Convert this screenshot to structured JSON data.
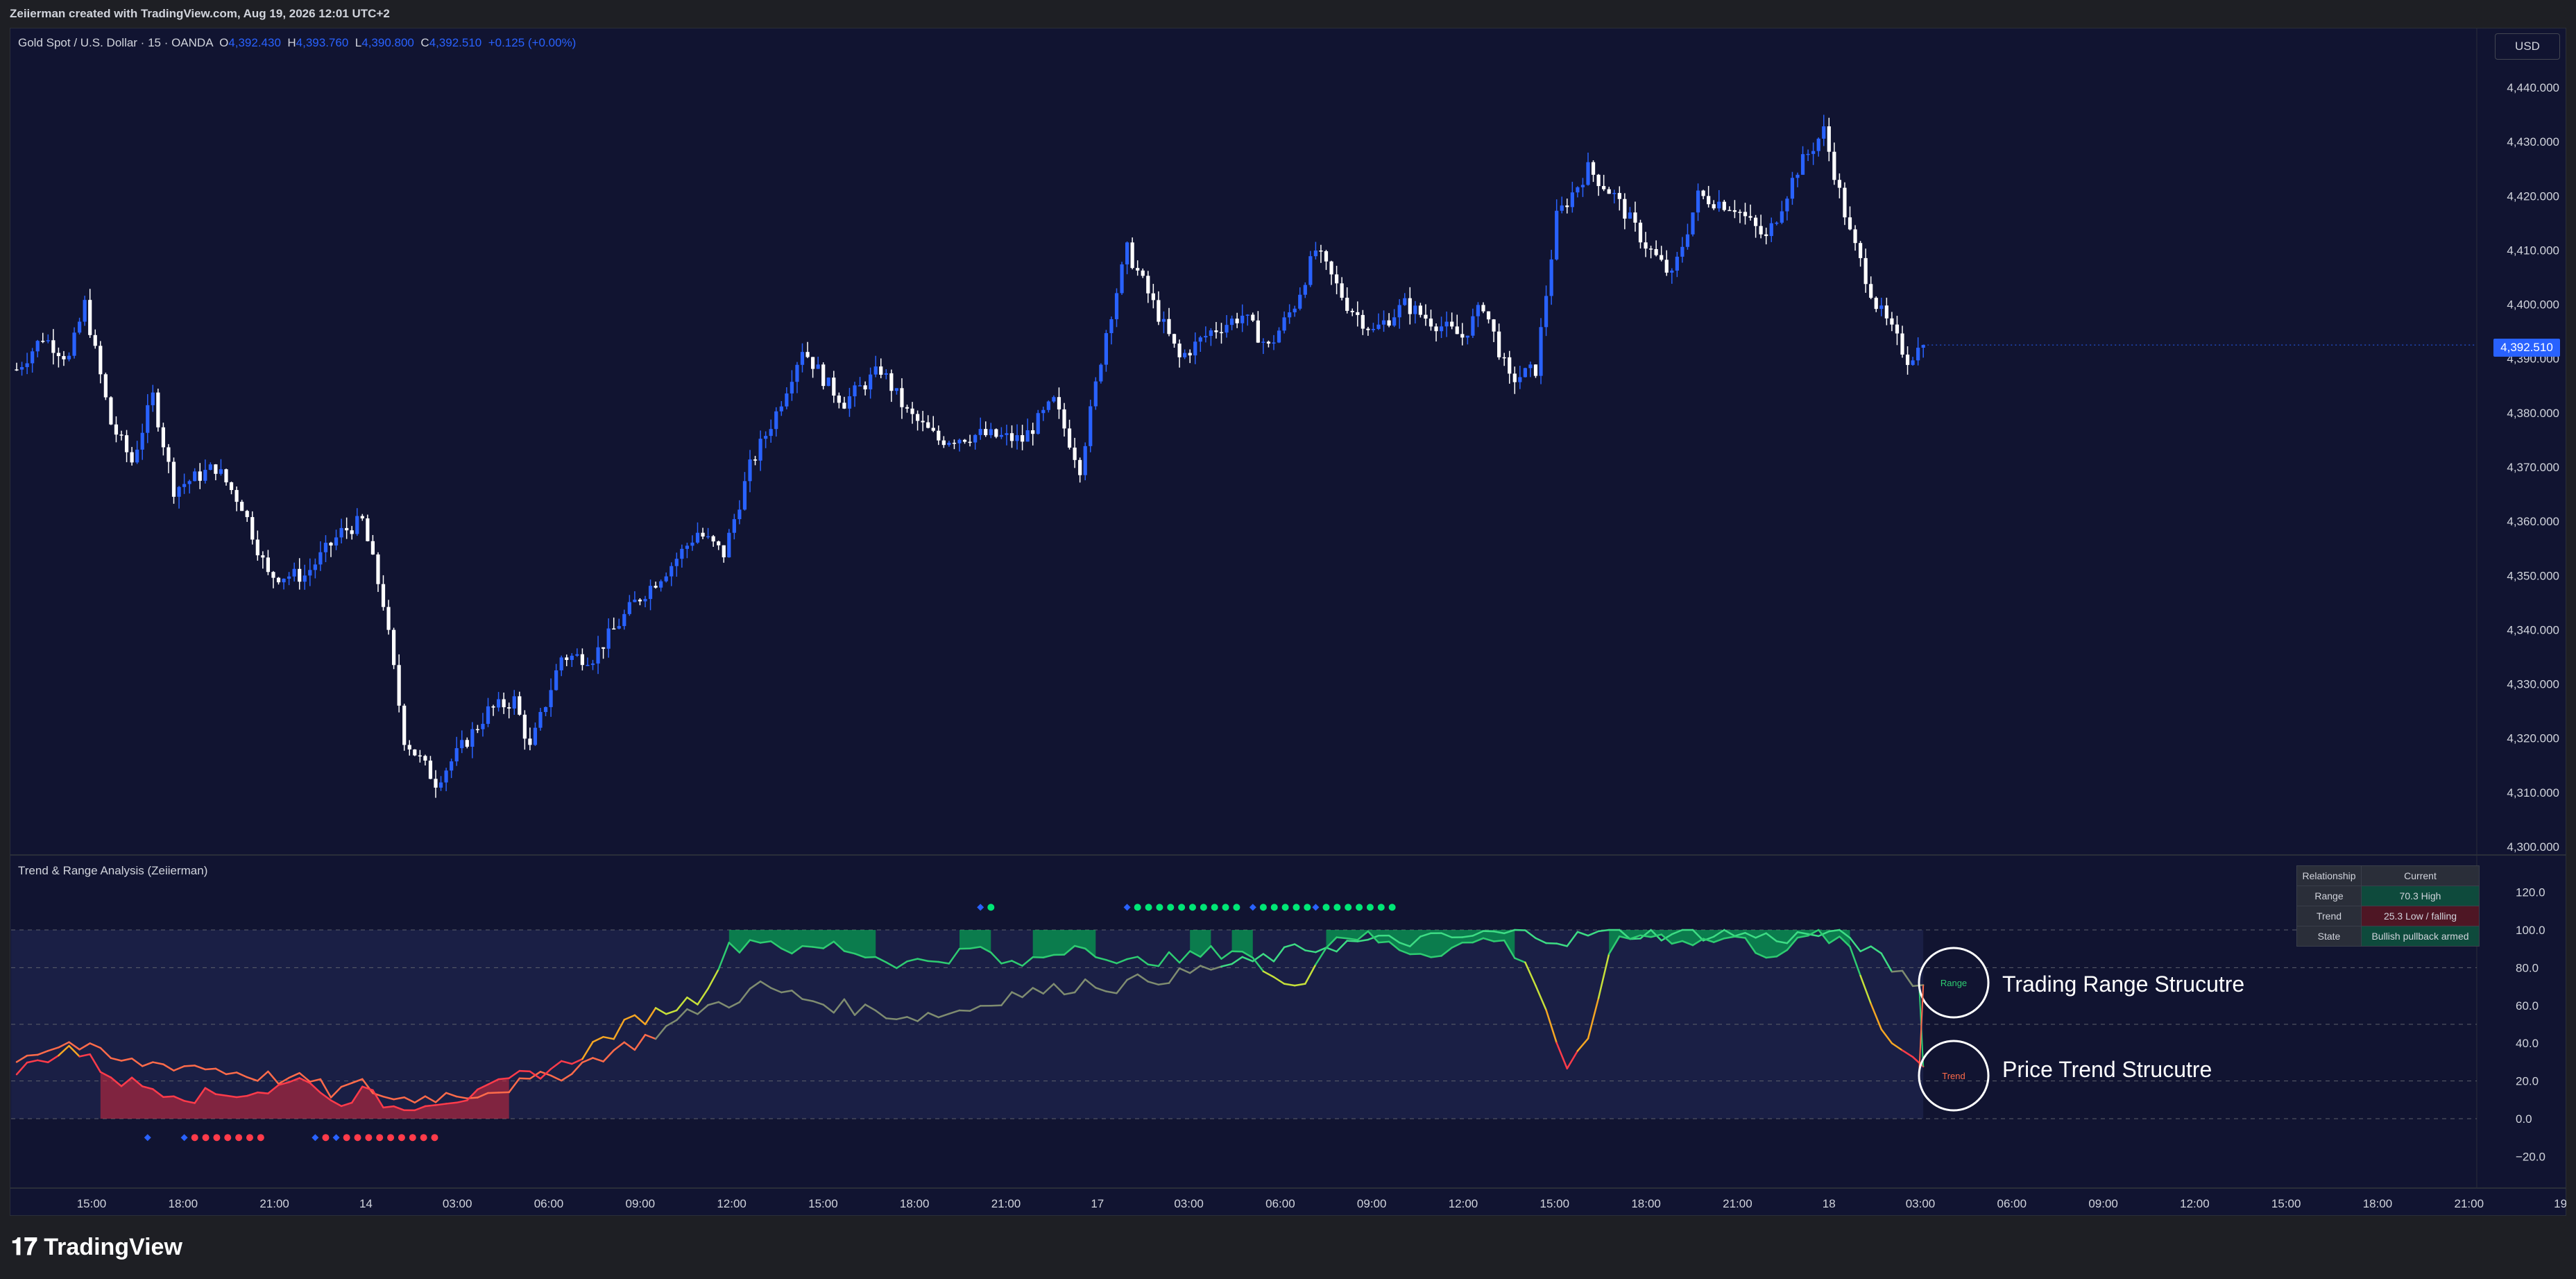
{
  "caption": "Zeiierman created with TradingView.com, Aug 19, 2026 12:01 UTC+2",
  "symbol": {
    "name": "Gold Spot / U.S. Dollar · 15 · OANDA",
    "o_label": "O",
    "o": "4,392.430",
    "h_label": "H",
    "h": "4,393.760",
    "l_label": "L",
    "l": "4,390.800",
    "c_label": "C",
    "c": "4,392.510",
    "change": "+0.125 (+0.00%)"
  },
  "currency": "USD",
  "last_price": "4,392.510",
  "price_axis": [
    "4,440.000",
    "4,430.000",
    "4,420.000",
    "4,410.000",
    "4,400.000",
    "4,390.000",
    "4,380.000",
    "4,370.000",
    "4,360.000",
    "4,350.000",
    "4,340.000",
    "4,330.000",
    "4,320.000",
    "4,310.000",
    "4,300.000"
  ],
  "indicator": {
    "title": "Trend & Range Analysis (Zeiierman)",
    "axis": [
      "120.0",
      "100.0",
      "80.0",
      "60.0",
      "40.0",
      "20.0",
      "0.0",
      "−20.0"
    ],
    "table": {
      "headers": [
        "Relationship",
        "Current"
      ],
      "rows": [
        {
          "label": "Range",
          "value": "70.3  High"
        },
        {
          "label": "Trend",
          "value": "25.3  Low / falling"
        },
        {
          "label": "State",
          "value": "Bullish pullback armed"
        }
      ]
    },
    "range_marker": "Range",
    "trend_marker": "Trend",
    "range_label": "Trading Range Strucutre",
    "trend_label": "Price Trend Strucutre"
  },
  "time_axis": [
    "15:00",
    "18:00",
    "21:00",
    "14",
    "03:00",
    "06:00",
    "09:00",
    "12:00",
    "15:00",
    "18:00",
    "21:00",
    "17",
    "03:00",
    "06:00",
    "09:00",
    "12:00",
    "15:00",
    "18:00",
    "21:00",
    "18",
    "03:00",
    "06:00",
    "09:00",
    "12:00",
    "15:00",
    "18:00",
    "21:00",
    "19"
  ],
  "footer_logo": "TradingView",
  "colors": {
    "background": "#111431",
    "up_candle": "#2962ff",
    "down_candle": "#ffffff",
    "range_line": "#00e676",
    "trend_line": "#ff5252",
    "accent": "#2962ff"
  },
  "chart_data": {
    "type": "candlestick",
    "price_range": [
      4300,
      4440
    ],
    "last_close": 4392.51,
    "price_path": [
      [
        0,
        4388
      ],
      [
        5,
        4394
      ],
      [
        10,
        4390
      ],
      [
        13,
        4400
      ],
      [
        18,
        4378
      ],
      [
        22,
        4371
      ],
      [
        26,
        4383
      ],
      [
        30,
        4366
      ],
      [
        38,
        4370
      ],
      [
        43,
        4363
      ],
      [
        48,
        4350
      ],
      [
        55,
        4350
      ],
      [
        62,
        4358
      ],
      [
        66,
        4360
      ],
      [
        70,
        4345
      ],
      [
        74,
        4320
      ],
      [
        80,
        4312
      ],
      [
        84,
        4317
      ],
      [
        90,
        4325
      ],
      [
        95,
        4327
      ],
      [
        98,
        4318
      ],
      [
        104,
        4335
      ],
      [
        110,
        4335
      ],
      [
        118,
        4345
      ],
      [
        125,
        4352
      ],
      [
        130,
        4358
      ],
      [
        135,
        4354
      ],
      [
        140,
        4370
      ],
      [
        145,
        4380
      ],
      [
        150,
        4392
      ],
      [
        155,
        4385
      ],
      [
        158,
        4382
      ],
      [
        165,
        4388
      ],
      [
        170,
        4380
      ],
      [
        176,
        4375
      ],
      [
        184,
        4376
      ],
      [
        192,
        4375
      ],
      [
        198,
        4382
      ],
      [
        203,
        4370
      ],
      [
        208,
        4395
      ],
      [
        212,
        4410
      ],
      [
        217,
        4400
      ],
      [
        222,
        4390
      ],
      [
        228,
        4395
      ],
      [
        234,
        4398
      ],
      [
        239,
        4392
      ],
      [
        244,
        4400
      ],
      [
        248,
        4410
      ],
      [
        254,
        4400
      ],
      [
        259,
        4395
      ],
      [
        265,
        4400
      ],
      [
        270,
        4397
      ],
      [
        276,
        4394
      ],
      [
        280,
        4400
      ],
      [
        285,
        4386
      ],
      [
        290,
        4388
      ],
      [
        294,
        4416
      ],
      [
        300,
        4425
      ],
      [
        305,
        4420
      ],
      [
        311,
        4411
      ],
      [
        316,
        4405
      ],
      [
        321,
        4420
      ],
      [
        328,
        4418
      ],
      [
        334,
        4412
      ],
      [
        340,
        4425
      ],
      [
        345,
        4432
      ],
      [
        350,
        4413
      ],
      [
        355,
        4400
      ],
      [
        358,
        4395
      ],
      [
        361,
        4390
      ],
      [
        364,
        4392.51
      ]
    ],
    "range_series": [
      [
        0,
        25
      ],
      [
        10,
        38
      ],
      [
        20,
        20
      ],
      [
        34,
        12
      ],
      [
        48,
        15
      ],
      [
        56,
        22
      ],
      [
        60,
        8
      ],
      [
        66,
        14
      ],
      [
        72,
        6
      ],
      [
        80,
        10
      ],
      [
        88,
        12
      ],
      [
        96,
        22
      ],
      [
        104,
        28
      ],
      [
        112,
        42
      ],
      [
        118,
        52
      ],
      [
        124,
        58
      ],
      [
        130,
        64
      ],
      [
        136,
        90
      ],
      [
        142,
        96
      ],
      [
        150,
        88
      ],
      [
        156,
        92
      ],
      [
        162,
        87
      ],
      [
        170,
        82
      ],
      [
        178,
        86
      ],
      [
        184,
        90
      ],
      [
        190,
        80
      ],
      [
        198,
        88
      ],
      [
        204,
        94
      ],
      [
        210,
        80
      ],
      [
        216,
        85
      ],
      [
        222,
        84
      ],
      [
        228,
        88
      ],
      [
        234,
        90
      ],
      [
        240,
        72
      ],
      [
        246,
        75
      ],
      [
        252,
        98
      ],
      [
        258,
        96
      ],
      [
        264,
        90
      ],
      [
        270,
        88
      ],
      [
        276,
        92
      ],
      [
        282,
        96
      ],
      [
        288,
        84
      ],
      [
        292,
        58
      ],
      [
        296,
        24
      ],
      [
        300,
        40
      ],
      [
        304,
        90
      ],
      [
        310,
        98
      ],
      [
        316,
        96
      ],
      [
        322,
        94
      ],
      [
        328,
        96
      ],
      [
        334,
        88
      ],
      [
        338,
        90
      ],
      [
        344,
        98
      ],
      [
        350,
        90
      ],
      [
        356,
        48
      ],
      [
        360,
        38
      ],
      [
        364,
        27
      ]
    ],
    "trend_series": [
      [
        0,
        33
      ],
      [
        10,
        40
      ],
      [
        20,
        30
      ],
      [
        34,
        28
      ],
      [
        48,
        22
      ],
      [
        56,
        20
      ],
      [
        60,
        14
      ],
      [
        66,
        18
      ],
      [
        72,
        10
      ],
      [
        80,
        12
      ],
      [
        88,
        14
      ],
      [
        96,
        18
      ],
      [
        104,
        24
      ],
      [
        112,
        34
      ],
      [
        118,
        40
      ],
      [
        124,
        48
      ],
      [
        130,
        58
      ],
      [
        136,
        62
      ],
      [
        142,
        70
      ],
      [
        150,
        64
      ],
      [
        156,
        60
      ],
      [
        162,
        58
      ],
      [
        170,
        54
      ],
      [
        178,
        56
      ],
      [
        184,
        60
      ],
      [
        190,
        66
      ],
      [
        198,
        68
      ],
      [
        204,
        72
      ],
      [
        210,
        70
      ],
      [
        216,
        74
      ],
      [
        222,
        76
      ],
      [
        228,
        80
      ],
      [
        234,
        82
      ],
      [
        240,
        86
      ],
      [
        246,
        90
      ],
      [
        252,
        92
      ],
      [
        258,
        94
      ],
      [
        264,
        94
      ],
      [
        270,
        95
      ],
      [
        276,
        96
      ],
      [
        282,
        98
      ],
      [
        288,
        98
      ],
      [
        292,
        97
      ],
      [
        296,
        94
      ],
      [
        300,
        98
      ],
      [
        304,
        98
      ],
      [
        310,
        98
      ],
      [
        316,
        98
      ],
      [
        322,
        98
      ],
      [
        328,
        98
      ],
      [
        334,
        96
      ],
      [
        338,
        96
      ],
      [
        344,
        98
      ],
      [
        350,
        96
      ],
      [
        356,
        84
      ],
      [
        360,
        76
      ],
      [
        364,
        70
      ]
    ],
    "indicator_range": [
      -25,
      125
    ]
  }
}
